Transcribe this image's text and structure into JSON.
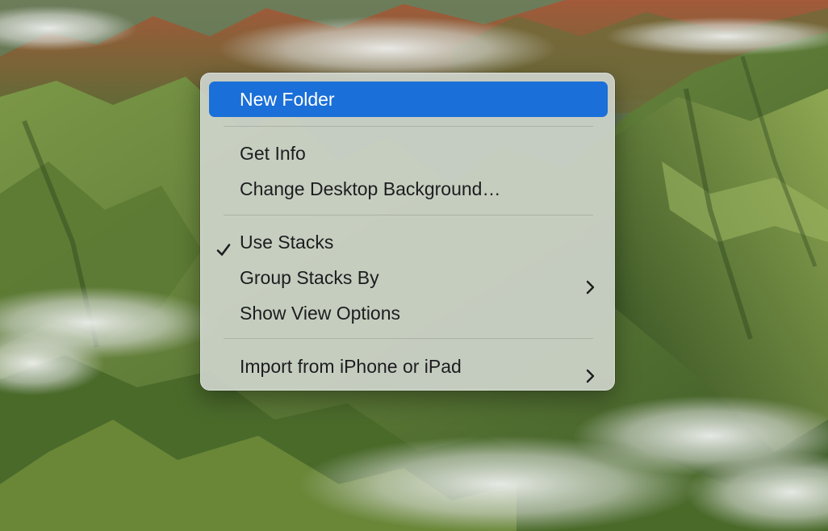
{
  "desktop": {
    "background_name": "green-mountains-with-clouds-wallpaper"
  },
  "context_menu": {
    "items": [
      {
        "label": "New Folder",
        "selected": true,
        "checked": false,
        "submenu": false
      },
      {
        "label": "Get Info",
        "selected": false,
        "checked": false,
        "submenu": false
      },
      {
        "label": "Change Desktop Background…",
        "selected": false,
        "checked": false,
        "submenu": false
      },
      {
        "label": "Use Stacks",
        "selected": false,
        "checked": true,
        "submenu": false
      },
      {
        "label": "Group Stacks By",
        "selected": false,
        "checked": false,
        "submenu": true
      },
      {
        "label": "Show View Options",
        "selected": false,
        "checked": false,
        "submenu": false
      },
      {
        "label": "Import from iPhone or iPad",
        "selected": false,
        "checked": false,
        "submenu": true
      }
    ],
    "icons": {
      "check": "checkmark-icon",
      "submenu": "chevron-right-icon"
    }
  },
  "colors": {
    "highlight": "#1a6fd8",
    "menu_text": "#1d1d1f",
    "highlight_text": "#ffffff"
  }
}
